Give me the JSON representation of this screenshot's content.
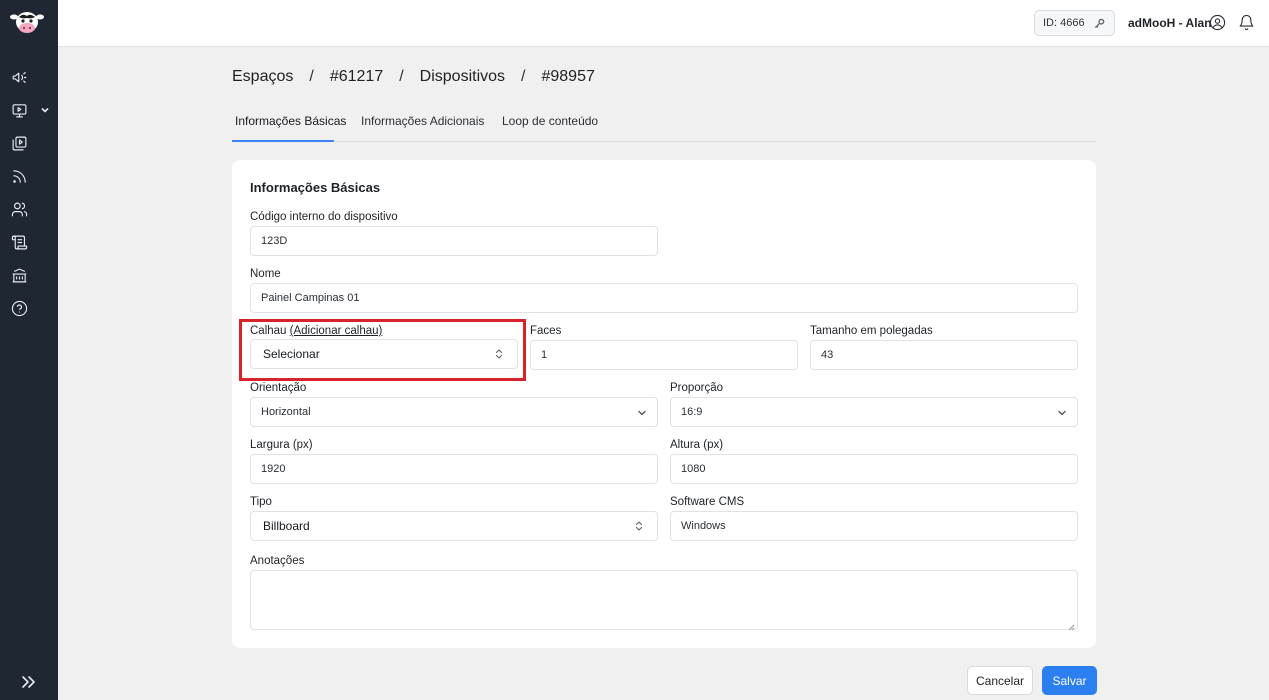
{
  "sidebar": {
    "logo": "cow-logo",
    "icons": [
      "megaphone-icon",
      "monitor-play-icon",
      "video-library-icon",
      "rss-icon",
      "users-icon",
      "scroll-icon",
      "bank-icon",
      "help-circle-icon"
    ],
    "expand_icon": "double-chevron-right-icon"
  },
  "topbar": {
    "id_badge": "ID: 4666",
    "user_name": "adMooH - Alan"
  },
  "breadcrumb": [
    "Espaços",
    "#61217",
    "Dispositivos",
    "#98957"
  ],
  "breadcrumb_separator": "/",
  "tabs": [
    {
      "label": "Informações Básicas",
      "active": true
    },
    {
      "label": "Informações Adicionais",
      "active": false
    },
    {
      "label": "Loop de conteúdo",
      "active": false
    }
  ],
  "form": {
    "title": "Informações Básicas",
    "codigo": {
      "label": "Código interno do dispositivo",
      "value": "123D"
    },
    "nome": {
      "label": "Nome",
      "value": "Painel Campinas 01"
    },
    "calhau": {
      "label": "Calhau",
      "link": "(Adicionar calhau)",
      "value": "Selecionar"
    },
    "faces": {
      "label": "Faces",
      "value": "1"
    },
    "tamanho": {
      "label": "Tamanho em polegadas",
      "value": "43"
    },
    "orientacao": {
      "label": "Orientação",
      "value": "Horizontal"
    },
    "proporcao": {
      "label": "Proporção",
      "value": "16:9"
    },
    "largura": {
      "label": "Largura (px)",
      "value": "1920"
    },
    "altura": {
      "label": "Altura (px)",
      "value": "1080"
    },
    "tipo": {
      "label": "Tipo",
      "value": "Billboard"
    },
    "software": {
      "label": "Software CMS",
      "value": "Windows"
    },
    "anotacoes": {
      "label": "Anotações",
      "value": ""
    }
  },
  "actions": {
    "cancel": "Cancelar",
    "save": "Salvar"
  },
  "colors": {
    "sidebar": "#1f2733",
    "primary": "#2b7ff0",
    "highlight": "#d9232a",
    "tab_active": "#3b82f6"
  }
}
